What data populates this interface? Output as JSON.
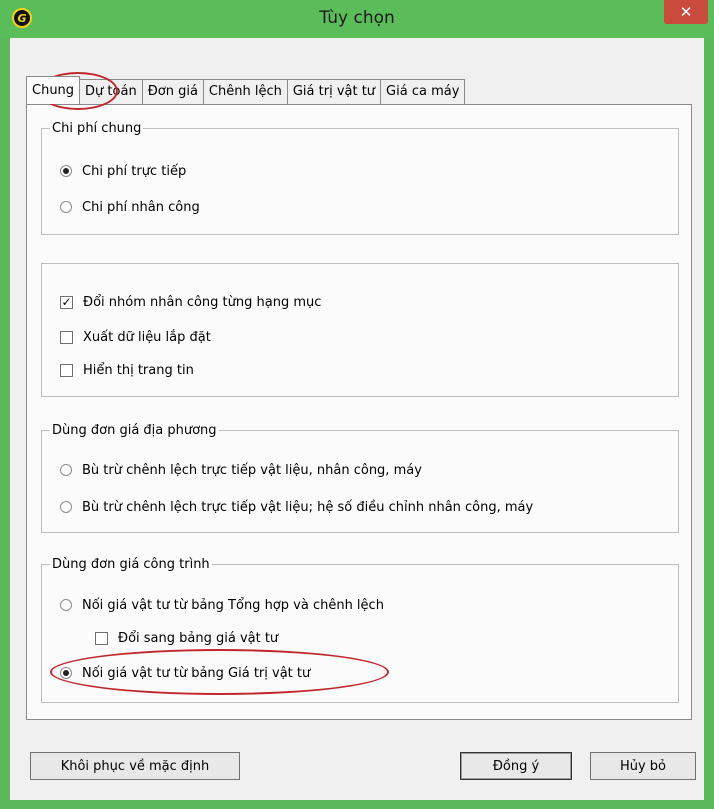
{
  "window": {
    "title": "Tùy chọn",
    "close_glyph": "✕"
  },
  "tabs": [
    {
      "label": "Chung",
      "active": true
    },
    {
      "label": "Dự toán"
    },
    {
      "label": "Đơn giá"
    },
    {
      "label": "Chênh lệch"
    },
    {
      "label": "Giá trị vật tư"
    },
    {
      "label": "Giá ca máy"
    }
  ],
  "group_chi_phi_chung": {
    "legend": "Chi phí chung",
    "options": [
      {
        "label": "Chi phí trực tiếp",
        "selected": true
      },
      {
        "label": "Chi phí nhân công",
        "selected": false
      }
    ]
  },
  "group_options": {
    "checkboxes": [
      {
        "label": "Đổi nhóm nhân công từng hạng mục",
        "checked": true
      },
      {
        "label": "Xuất dữ liệu lắp đặt",
        "checked": false
      },
      {
        "label": "Hiển thị trang tin",
        "checked": false
      }
    ]
  },
  "group_don_gia_dia_phuong": {
    "legend": "Dùng đơn giá địa phương",
    "options": [
      {
        "label": "Bù trừ chênh lệch trực tiếp vật liệu, nhân công, máy",
        "selected": false
      },
      {
        "label": "Bù trừ chênh lệch trực tiếp vật liệu; hệ số điều chỉnh nhân công, máy",
        "selected": false
      }
    ]
  },
  "group_don_gia_cong_trinh": {
    "legend": "Dùng đơn giá công trình",
    "options": [
      {
        "label": "Nối giá vật tư từ bảng Tổng hợp và chênh lệch",
        "selected": false
      },
      {
        "label": "Nối giá vật tư từ bảng Giá trị vật tư",
        "selected": true
      }
    ],
    "sub_checkbox": {
      "label": "Đổi sang bảng giá vật tư",
      "checked": false
    }
  },
  "buttons": {
    "reset": "Khôi phục về mặc định",
    "ok": "Đồng ý",
    "cancel": "Hủy bỏ"
  },
  "colors": {
    "titlebar": "#5bbd59",
    "close": "#c94b3e",
    "annotation": "#c0282d"
  }
}
